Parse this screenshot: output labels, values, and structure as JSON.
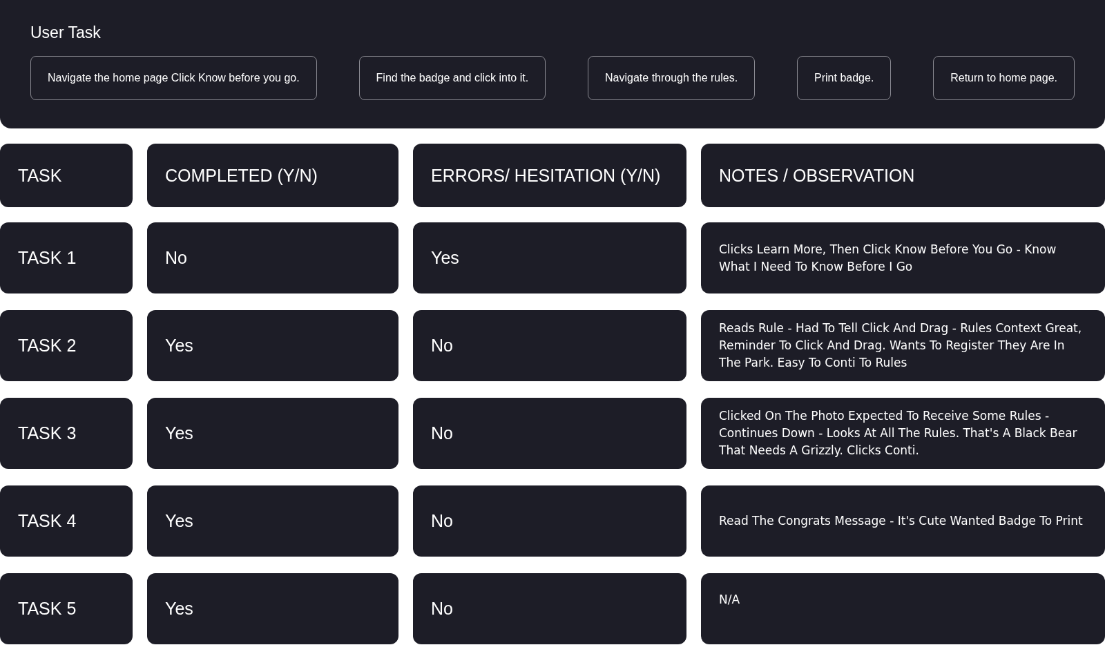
{
  "user_task": {
    "title": "User Task",
    "tasks": [
      "Navigate the home page Click Know before you go.",
      "Find the badge and click into it.",
      "Navigate through the rules.",
      "Print badge.",
      "Return to home page."
    ]
  },
  "table": {
    "columns": [
      "TASK",
      "COMPLETED (Y/N)",
      "ERRORS/ HESITATION (Y/N)",
      "NOTES / OBSERVATION"
    ],
    "rows": [
      {
        "task": "TASK 1",
        "completed": "No",
        "errors": "Yes",
        "notes": "Clicks Learn More, Then Click Know Before You Go - Know What I Need To Know Before I Go"
      },
      {
        "task": "TASK 2",
        "completed": "Yes",
        "errors": "No",
        "notes": "Reads Rule - Had To Tell Click And Drag - Rules Context Great, Reminder To Click And Drag. Wants To Register They Are In The Park. Easy To Conti To Rules"
      },
      {
        "task": "TASK 3",
        "completed": "Yes",
        "errors": "No",
        "notes": "Clicked On The Photo Expected To Receive Some Rules - Continues Down - Looks At All The Rules. That's A Black Bear That Needs A Grizzly. Clicks Conti."
      },
      {
        "task": "TASK 4",
        "completed": "Yes",
        "errors": "No",
        "notes": "Read The Congrats Message - It's Cute Wanted Badge To Print"
      },
      {
        "task": "TASK 5",
        "completed": "Yes",
        "errors": "No",
        "notes": "N/A"
      }
    ]
  }
}
